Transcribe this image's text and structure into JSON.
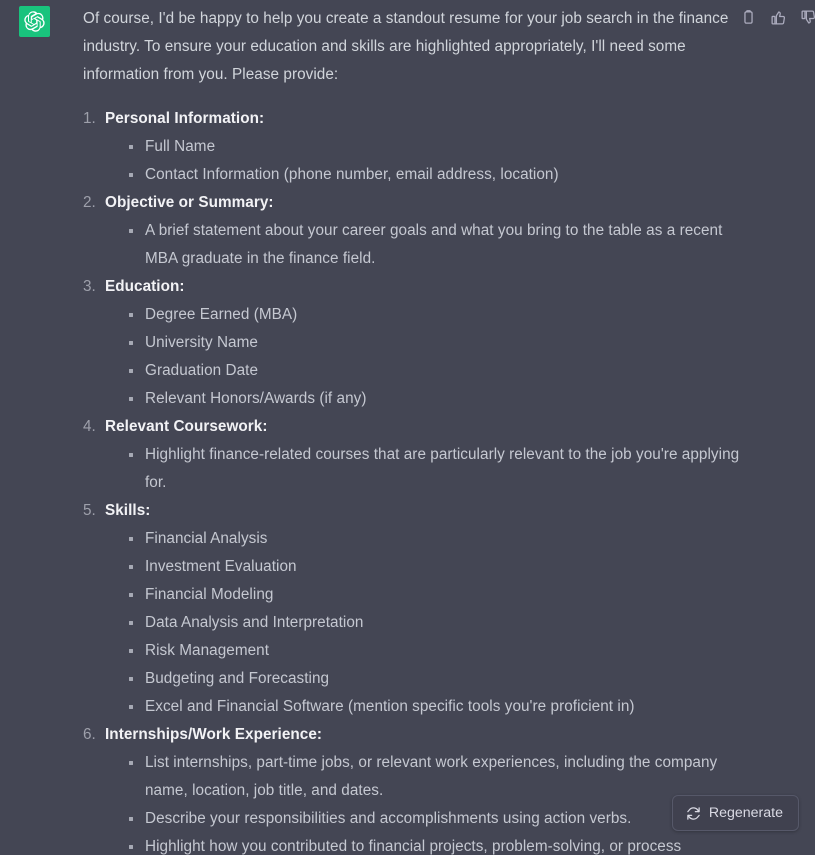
{
  "avatar": {
    "name": "chatgpt-logo",
    "color": "#19c37d"
  },
  "actions": [
    {
      "name": "copy-icon",
      "label": "Copy"
    },
    {
      "name": "thumbs-up-icon",
      "label": "Good response"
    },
    {
      "name": "thumbs-down-icon",
      "label": "Bad response"
    }
  ],
  "message": {
    "intro": "Of course, I'd be happy to help you create a standout resume for your job search in the finance industry. To ensure your education and skills are highlighted appropriately, I'll need some information from you. Please provide:",
    "items": [
      {
        "number": "1.",
        "label": "Personal Information:",
        "bullets": [
          "Full Name",
          "Contact Information (phone number, email address, location)"
        ]
      },
      {
        "number": "2.",
        "label": "Objective or Summary:",
        "bullets": [
          "A brief statement about your career goals and what you bring to the table as a recent MBA graduate in the finance field."
        ]
      },
      {
        "number": "3.",
        "label": "Education:",
        "bullets": [
          "Degree Earned (MBA)",
          "University Name",
          "Graduation Date",
          "Relevant Honors/Awards (if any)"
        ]
      },
      {
        "number": "4.",
        "label": "Relevant Coursework:",
        "bullets": [
          "Highlight finance-related courses that are particularly relevant to the job you're applying for."
        ]
      },
      {
        "number": "5.",
        "label": "Skills:",
        "bullets": [
          "Financial Analysis",
          "Investment Evaluation",
          "Financial Modeling",
          "Data Analysis and Interpretation",
          "Risk Management",
          "Budgeting and Forecasting",
          "Excel and Financial Software (mention specific tools you're proficient in)"
        ]
      },
      {
        "number": "6.",
        "label": "Internships/Work Experience:",
        "bullets": [
          "List internships, part-time jobs, or relevant work experiences, including the company name, location, job title, and dates.",
          "Describe your responsibilities and accomplishments using action verbs.",
          "Highlight how you contributed to financial projects, problem-solving, or process"
        ]
      }
    ]
  },
  "regenerate": {
    "label": "Regenerate",
    "icon": "refresh-icon"
  },
  "theme": {
    "background": "#444654",
    "text": "#d1d5db",
    "heading": "#f2f2f5",
    "accent": "#19c37d",
    "button_bg": "#40414f",
    "button_border": "#565869"
  }
}
